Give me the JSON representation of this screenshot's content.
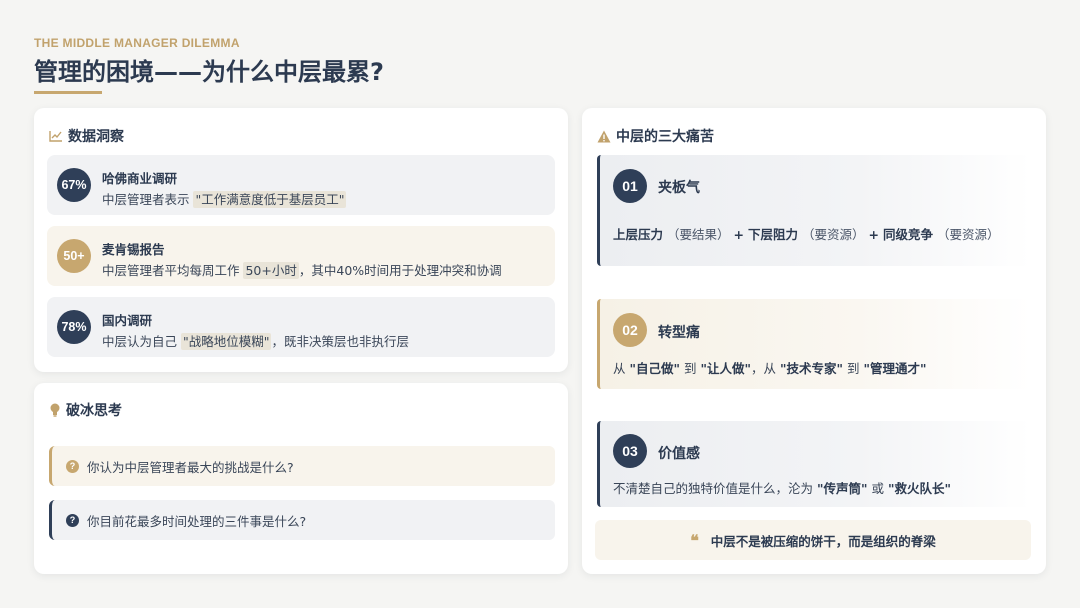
{
  "header": {
    "eyebrow": "THE MIDDLE MANAGER DILEMMA",
    "title": "管理的困境——为什么中层最累?"
  },
  "insights": {
    "heading": "数据洞察",
    "icon": "line-chart-icon",
    "items": [
      {
        "badge": "67%",
        "name": "哈佛商业调研",
        "desc_before": "中层管理者表示 ",
        "desc_highlight": "\"工作满意度低于基层员工\"",
        "desc_after": ""
      },
      {
        "badge": "50+",
        "name": "麦肯锡报告",
        "desc_before": "中层管理者平均每周工作 ",
        "desc_highlight": "50+小时",
        "desc_after": "，其中40%时间用于处理冲突和协调"
      },
      {
        "badge": "78%",
        "name": "国内调研",
        "desc_before": "中层认为自己 ",
        "desc_highlight": "\"战略地位模糊\"",
        "desc_after": "，既非决策层也非执行层"
      }
    ]
  },
  "icebreaker": {
    "heading": "破冰思考",
    "icon": "lightbulb-icon",
    "questions": [
      "你认为中层管理者最大的挑战是什么?",
      "你目前花最多时间处理的三件事是什么?"
    ]
  },
  "pains": {
    "heading": "中层的三大痛苦",
    "icon": "warning-icon",
    "items": [
      {
        "num": "01",
        "title": "夹板气",
        "seg1": "上层压力",
        "seg1_note": "（要结果）",
        "plus": "+",
        "seg2": "下层阻力",
        "seg2_note": "（要资源）",
        "seg3": "同级竞争",
        "seg3_note": "（要资源）"
      },
      {
        "num": "02",
        "title": "转型痛",
        "t1": "从 ",
        "b1": "\"自己做\"",
        "t2": " 到 ",
        "b2": "\"让人做\"",
        "t3": "，从 ",
        "b3": "\"技术专家\"",
        "t4": " 到 ",
        "b4": "\"管理通才\""
      },
      {
        "num": "03",
        "title": "价值感",
        "t1": "不清楚自己的独特价值是什么，沦为 ",
        "b1": "\"传声筒\"",
        "t2": " 或 ",
        "b2": "\"救火队长\""
      }
    ],
    "quote": "中层不是被压缩的饼干，而是组织的脊梁",
    "quote_mark": "❝"
  },
  "colors": {
    "navy": "#2f3f58",
    "gold": "#c7a76f",
    "background": "#f5f5f3"
  }
}
